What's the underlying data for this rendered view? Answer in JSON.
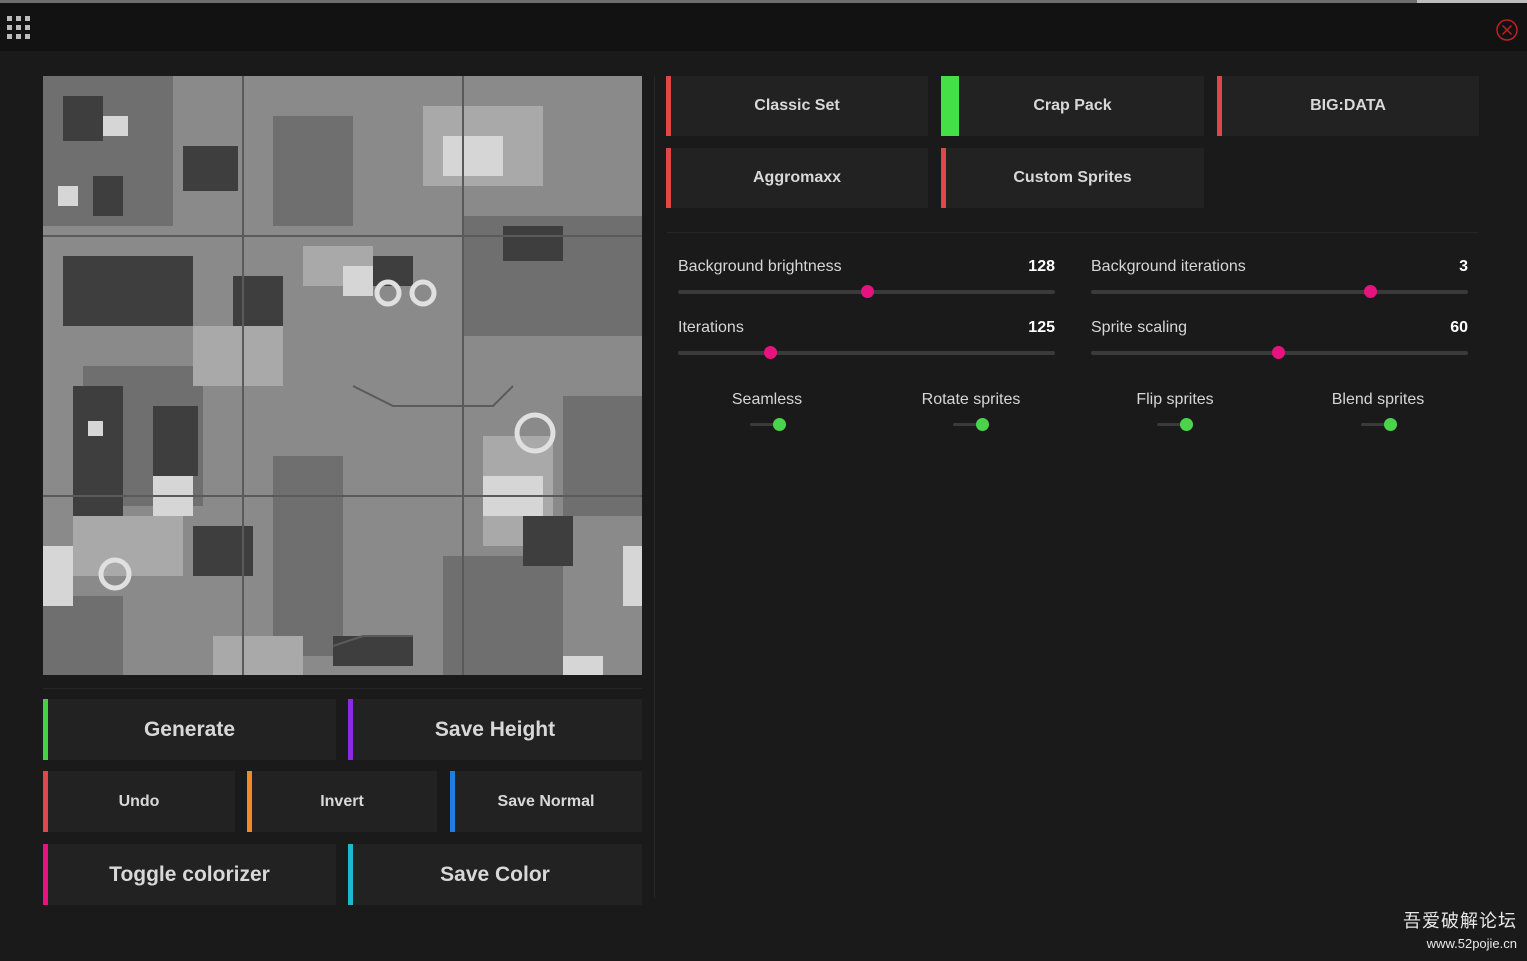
{
  "window": {
    "grid_icon": "grid-icon",
    "close_icon": "close-circle-icon"
  },
  "packs": [
    {
      "label": "Classic Set",
      "color": "#e04848",
      "selected": false
    },
    {
      "label": "Crap Pack",
      "color": "#45e045",
      "selected": true
    },
    {
      "label": "BIG:DATA",
      "color": "#e04848",
      "selected": false
    },
    {
      "label": "Aggromaxx",
      "color": "#e04848",
      "selected": false
    },
    {
      "label": "Custom Sprites",
      "color": "#e04848",
      "selected": false
    }
  ],
  "sliders": [
    {
      "label": "Background brightness",
      "value": "128",
      "fraction": 0.5
    },
    {
      "label": "Background iterations",
      "value": "3",
      "fraction": 0.74
    },
    {
      "label": "Iterations",
      "value": "125",
      "fraction": 0.245
    },
    {
      "label": "Sprite scaling",
      "value": "60",
      "fraction": 0.497
    }
  ],
  "toggles": [
    {
      "label": "Seamless",
      "on": true
    },
    {
      "label": "Rotate sprites",
      "on": true
    },
    {
      "label": "Flip sprites",
      "on": true
    },
    {
      "label": "Blend sprites",
      "on": true
    }
  ],
  "actions": {
    "generate": {
      "label": "Generate",
      "color": "#45d045"
    },
    "save_height": {
      "label": "Save Height",
      "color": "#8a2be2"
    },
    "undo": {
      "label": "Undo",
      "color": "#e04848"
    },
    "invert": {
      "label": "Invert",
      "color": "#f08a24"
    },
    "save_normal": {
      "label": "Save Normal",
      "color": "#1e7fe0"
    },
    "toggle_colorizer": {
      "label": "Toggle colorizer",
      "color": "#e5137f"
    },
    "save_color": {
      "label": "Save Color",
      "color": "#1cb8d0"
    }
  },
  "colors": {
    "slider_thumb": "#e5137f",
    "toggle_on": "#4bd44b",
    "background": "#1a1a1a",
    "button": "#222222"
  },
  "watermark": {
    "line1": "吾爱破解论坛",
    "line2": "www.52pojie.cn"
  }
}
